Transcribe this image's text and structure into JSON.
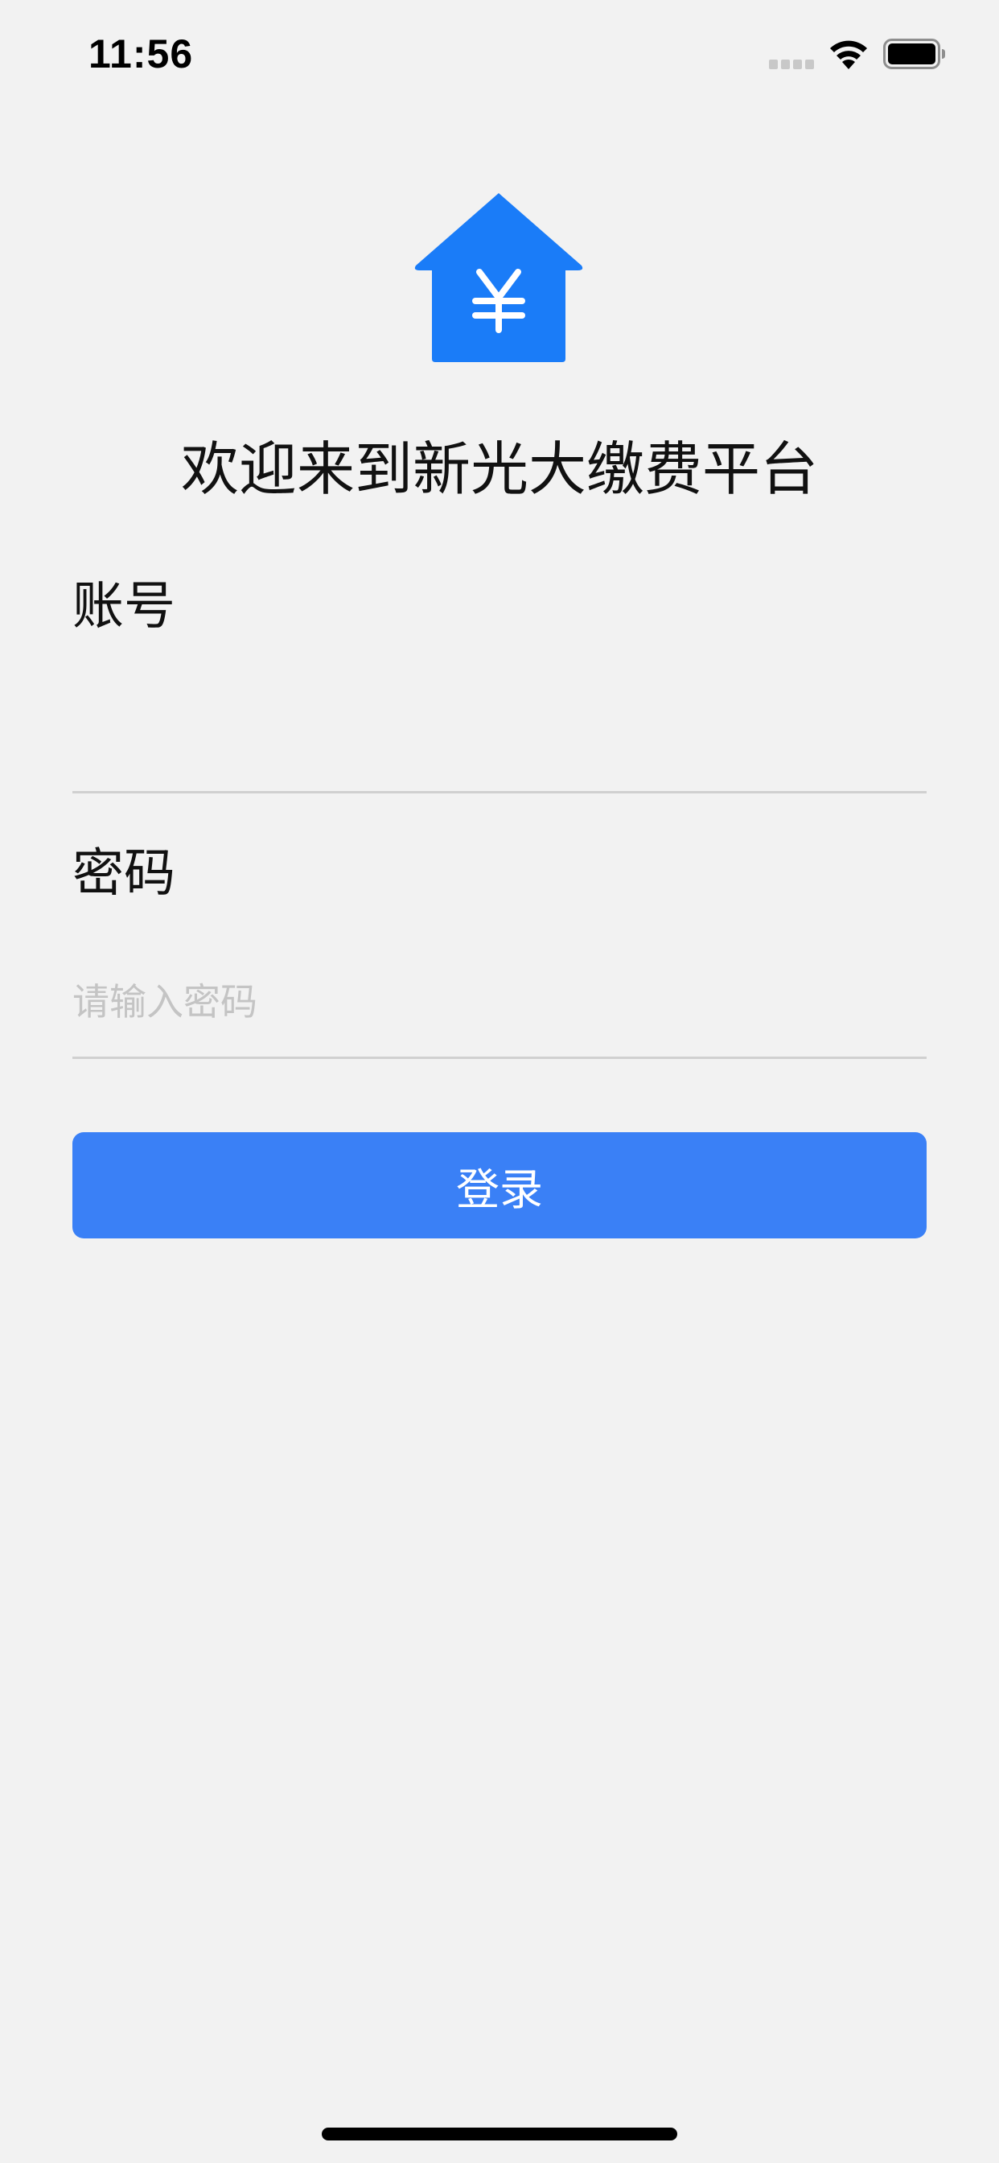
{
  "status_bar": {
    "time": "11:56"
  },
  "app": {
    "logo_icon": "house-yen-icon",
    "brand_color": "#1a7cf8",
    "welcome_title": "欢迎来到新光大缴费平台"
  },
  "form": {
    "account": {
      "label": "账号",
      "value": "",
      "placeholder": ""
    },
    "password": {
      "label": "密码",
      "value": "",
      "placeholder": "请输入密码"
    },
    "login_button": {
      "label": "登录",
      "color": "#3a80f6"
    }
  }
}
